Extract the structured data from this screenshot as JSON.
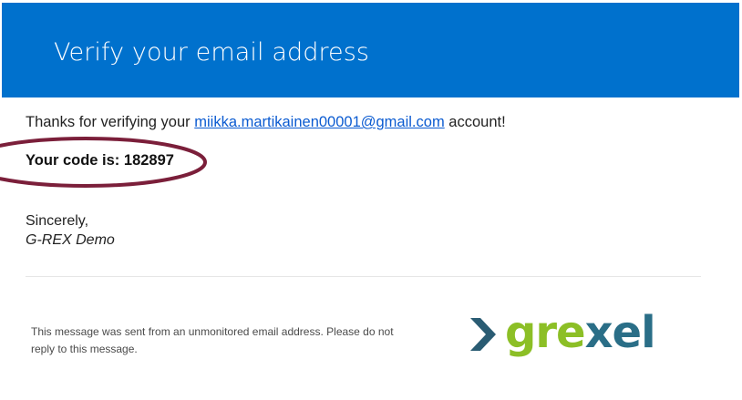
{
  "header": {
    "title": "Verify your email address",
    "color": "#0071cd"
  },
  "body": {
    "intro_before": "Thanks for verifying your ",
    "email": "miikka.martikainen00001@gmail.com",
    "intro_after": " account!",
    "code_label": "Your code is: ",
    "code_value": "182897",
    "closing": "Sincerely,",
    "signature": "G-REX Demo"
  },
  "highlight": {
    "color": "#7b1f3a"
  },
  "footer": {
    "note": "This message was sent from an unmonitored email address. Please do not reply to this message.",
    "logo_text": "grexel",
    "logo_colors": {
      "arrow": "#2a5c73",
      "gre": "#8cbf26",
      "xel": "#2a6e87"
    }
  }
}
